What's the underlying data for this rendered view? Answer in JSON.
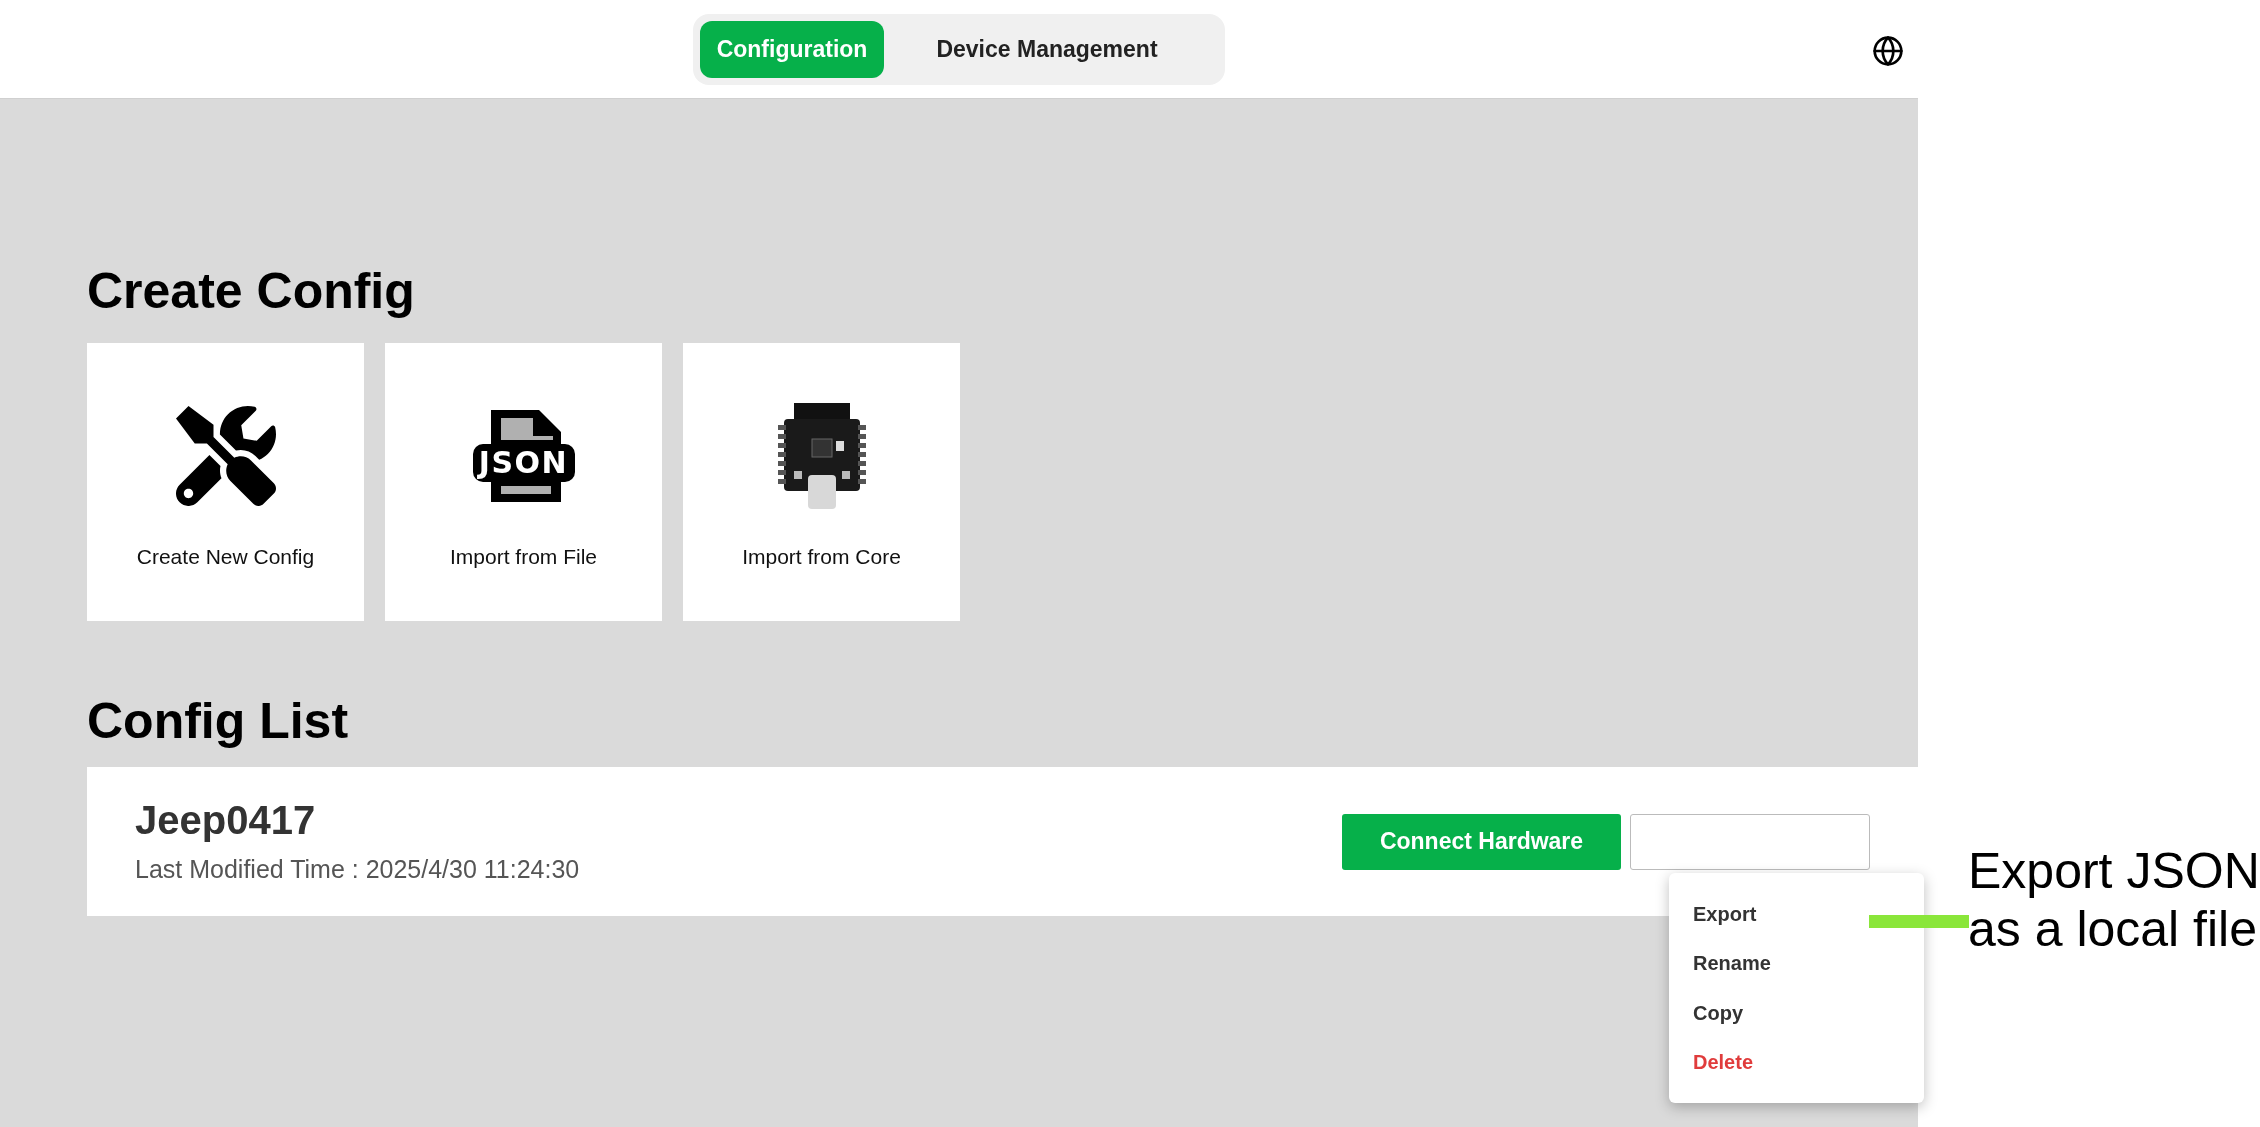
{
  "tabs": [
    {
      "label": "Configuration",
      "selected": true
    },
    {
      "label": "Device Management",
      "selected": false
    }
  ],
  "create_section": {
    "title": "Create Config",
    "cards": [
      {
        "kind": "tools",
        "label": "Create New Config"
      },
      {
        "kind": "file",
        "label": "Import from File",
        "icon_text": "JSON"
      },
      {
        "kind": "board",
        "label": "Import from Core"
      }
    ]
  },
  "config_section": {
    "title": "Config List",
    "items": [
      {
        "name": "Jeep0417",
        "modified": "Last Modified Time : 2025/4/30 11:24:30",
        "button": "Connect Hardware"
      }
    ]
  },
  "context_menu": [
    {
      "label": "Export",
      "kind": "normal"
    },
    {
      "label": "Rename",
      "kind": "normal"
    },
    {
      "label": "Copy",
      "kind": "normal"
    },
    {
      "label": "Delete",
      "kind": "danger"
    }
  ],
  "annotation": {
    "lines": [
      "Export JSON",
      "as a local file"
    ]
  }
}
